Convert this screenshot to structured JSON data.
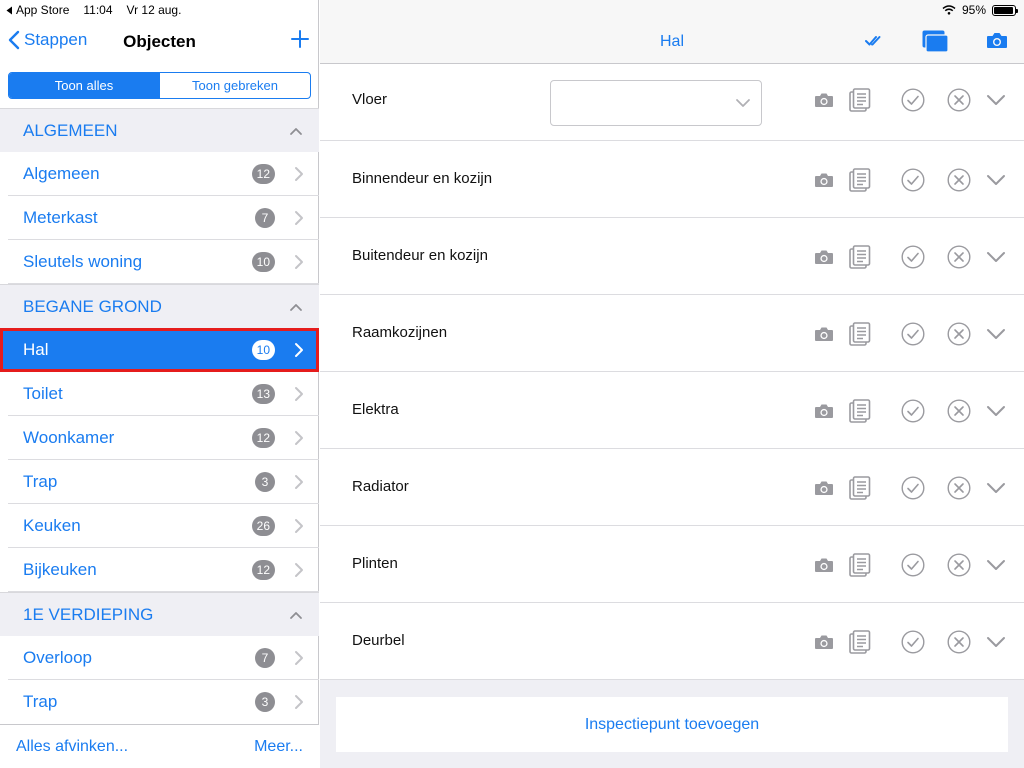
{
  "status_bar": {
    "back_app": "App Store",
    "time": "11:04",
    "date": "Vr 12 aug.",
    "battery": "95%",
    "battery_level": 0.95
  },
  "sidebar": {
    "back_label": "Stappen",
    "title": "Objecten",
    "segments": [
      "Toon alles",
      "Toon gebreken"
    ],
    "active_segment": 0,
    "sections": [
      {
        "title": "ALGEMEEN",
        "items": [
          {
            "label": "Algemeen",
            "count": "12"
          },
          {
            "label": "Meterkast",
            "count": "7"
          },
          {
            "label": "Sleutels woning",
            "count": "10"
          }
        ]
      },
      {
        "title": "BEGANE GROND",
        "items": [
          {
            "label": "Hal",
            "count": "10",
            "selected": true
          },
          {
            "label": "Toilet",
            "count": "13"
          },
          {
            "label": "Woonkamer",
            "count": "12"
          },
          {
            "label": "Trap",
            "count": "3"
          },
          {
            "label": "Keuken",
            "count": "26"
          },
          {
            "label": "Bijkeuken",
            "count": "12"
          }
        ]
      },
      {
        "title": "1E VERDIEPING",
        "items": [
          {
            "label": "Overloop",
            "count": "7"
          },
          {
            "label": "Trap",
            "count": "3"
          }
        ]
      }
    ],
    "footer": {
      "left": "Alles afvinken...",
      "right": "Meer..."
    }
  },
  "main": {
    "title": "Hal",
    "items": [
      {
        "label": "Vloer",
        "has_dropdown": true
      },
      {
        "label": "Binnendeur en kozijn"
      },
      {
        "label": "Buitendeur en kozijn"
      },
      {
        "label": "Raamkozijnen"
      },
      {
        "label": "Elektra"
      },
      {
        "label": "Radiator"
      },
      {
        "label": "Plinten"
      },
      {
        "label": "Deurbel"
      }
    ],
    "add_button": "Inspectiepunt toevoegen"
  },
  "colors": {
    "accent": "#1a7cf0",
    "icon_gray": "#9a9a9f",
    "highlight": "#e51c1c",
    "badge": "#8e8e93"
  }
}
